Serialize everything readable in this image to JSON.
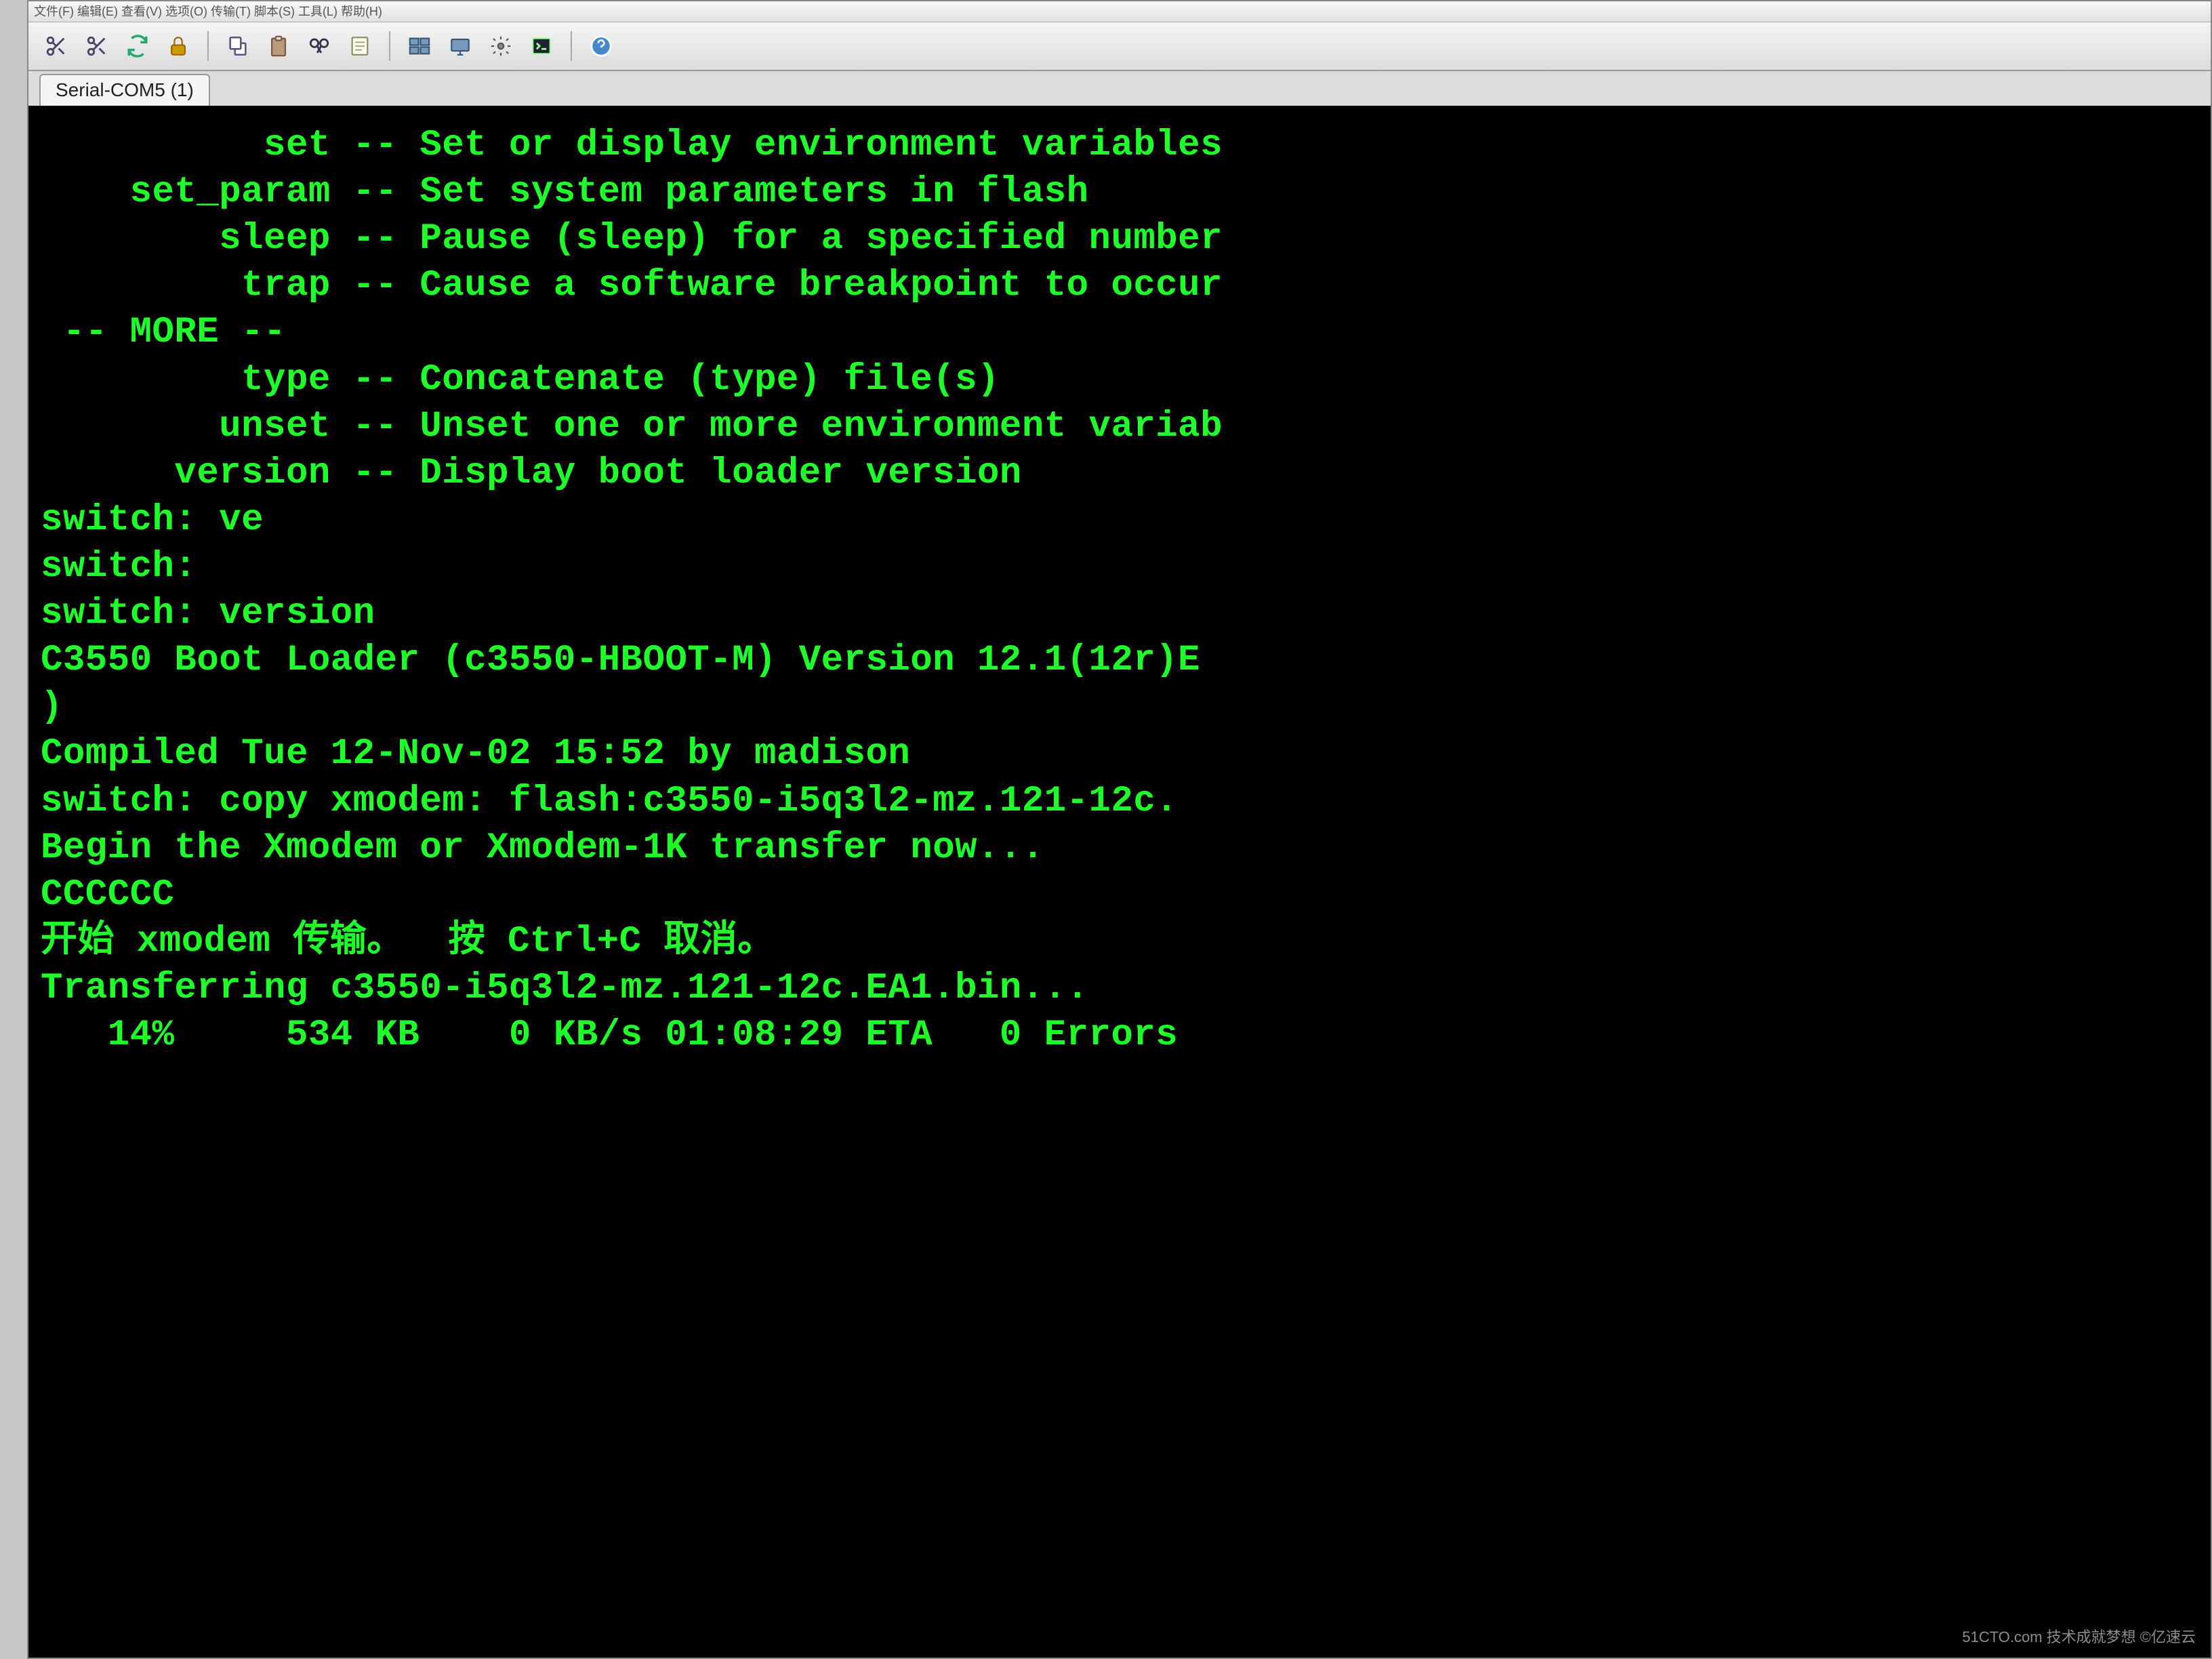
{
  "menubar": {
    "items": [
      "文件(F)",
      "编辑(E)",
      "查看(V)",
      "选项(O)",
      "传输(T)",
      "脚本(S)",
      "工具(L)",
      "帮助(H)"
    ]
  },
  "toolbar": {
    "icons": [
      "scissors-icon",
      "scissors-icon",
      "refresh-icon",
      "lock-icon",
      "copy-icon",
      "paste-icon",
      "find-icon",
      "notes-icon",
      "screens-icon",
      "screen-icon",
      "settings-icon",
      "prompt-icon",
      "help-icon"
    ]
  },
  "tab": {
    "label": "Serial-COM5 (1)"
  },
  "terminal": {
    "lines": [
      "          set -- Set or display environment variables",
      "    set_param -- Set system parameters in flash",
      "        sleep -- Pause (sleep) for a specified number",
      "         trap -- Cause a software breakpoint to occur",
      " -- MORE --",
      "         type -- Concatenate (type) file(s)",
      "        unset -- Unset one or more environment variab",
      "      version -- Display boot loader version",
      "switch: ve",
      "switch:",
      "switch: version",
      "C3550 Boot Loader (c3550-HBOOT-M) Version 12.1(12r)E",
      ")",
      "Compiled Tue 12-Nov-02 15:52 by madison",
      "switch: copy xmodem: flash:c3550-i5q3l2-mz.121-12c.",
      "Begin the Xmodem or Xmodem-1K transfer now...",
      "CCCCCC",
      "开始 xmodem 传输。  按 Ctrl+C 取消。",
      "Transferring c3550-i5q3l2-mz.121-12c.EA1.bin...",
      "   14%     534 KB    0 KB/s 01:08:29 ETA   0 Errors"
    ]
  },
  "transfer": {
    "percent": "14%",
    "size": "534 KB",
    "speed": "0 KB/s",
    "eta": "01:08:29",
    "errors": "0 Errors",
    "filename": "c3550-i5q3l2-mz.121-12c.EA1.bin"
  },
  "watermark": "51CTO.com 技术成就梦想 ©亿速云"
}
